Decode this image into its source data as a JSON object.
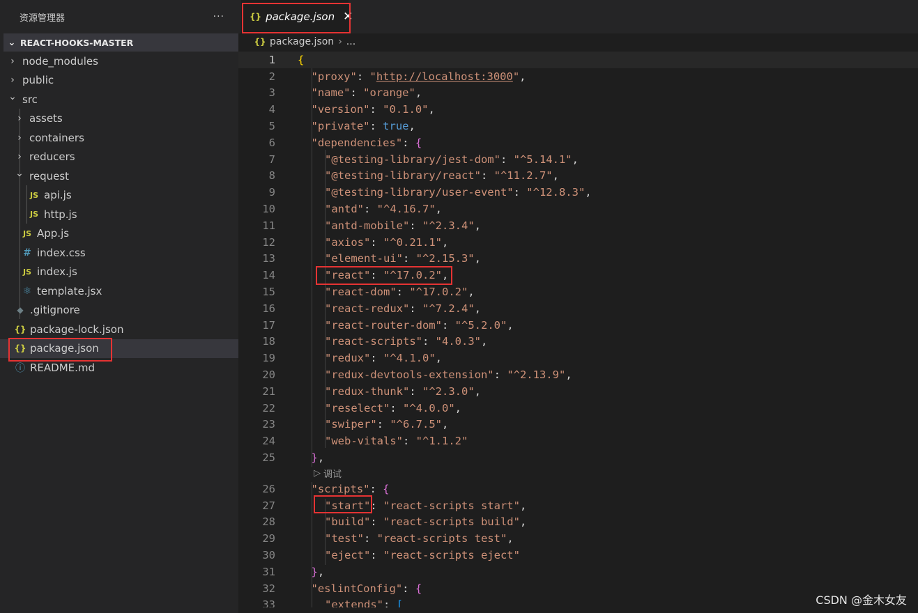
{
  "explorer": {
    "title": "资源管理器",
    "more_label": "···",
    "section_label": "REACT-HOOKS-MASTER",
    "items": [
      {
        "label": "node_modules",
        "kind": "folder",
        "expanded": false,
        "depth": 0,
        "icon": "chevron-right-icon"
      },
      {
        "label": "public",
        "kind": "folder",
        "expanded": false,
        "depth": 0,
        "icon": "chevron-right-icon"
      },
      {
        "label": "src",
        "kind": "folder",
        "expanded": true,
        "depth": 0,
        "icon": "chevron-down-icon"
      },
      {
        "label": "assets",
        "kind": "folder",
        "expanded": false,
        "depth": 1,
        "icon": "chevron-right-icon"
      },
      {
        "label": "containers",
        "kind": "folder",
        "expanded": false,
        "depth": 1,
        "icon": "chevron-right-icon"
      },
      {
        "label": "reducers",
        "kind": "folder",
        "expanded": false,
        "depth": 1,
        "icon": "chevron-right-icon"
      },
      {
        "label": "request",
        "kind": "folder",
        "expanded": true,
        "depth": 1,
        "icon": "chevron-down-icon"
      },
      {
        "label": "api.js",
        "kind": "file",
        "depth": 2,
        "icon": "js-file-icon",
        "glyph": "JS"
      },
      {
        "label": "http.js",
        "kind": "file",
        "depth": 2,
        "icon": "js-file-icon",
        "glyph": "JS"
      },
      {
        "label": "App.js",
        "kind": "file",
        "depth": 1,
        "icon": "js-file-icon",
        "glyph": "JS"
      },
      {
        "label": "index.css",
        "kind": "file",
        "depth": 1,
        "icon": "css-file-icon",
        "glyph": "#"
      },
      {
        "label": "index.js",
        "kind": "file",
        "depth": 1,
        "icon": "js-file-icon",
        "glyph": "JS"
      },
      {
        "label": "template.jsx",
        "kind": "file",
        "depth": 1,
        "icon": "react-file-icon",
        "glyph": "⚛"
      },
      {
        "label": ".gitignore",
        "kind": "file",
        "depth": 0,
        "icon": "git-file-icon",
        "glyph": "◆"
      },
      {
        "label": "package-lock.json",
        "kind": "file",
        "depth": 0,
        "icon": "json-file-icon",
        "glyph": "{}"
      },
      {
        "label": "package.json",
        "kind": "file",
        "depth": 0,
        "icon": "json-file-icon",
        "glyph": "{}",
        "selected": true
      },
      {
        "label": "README.md",
        "kind": "file",
        "depth": 0,
        "icon": "info-file-icon",
        "glyph": "ⓘ"
      }
    ]
  },
  "tab": {
    "glyph": "{}",
    "label": "package.json",
    "close": "✕"
  },
  "breadcrumb": {
    "glyph": "{}",
    "file": "package.json",
    "sep": "›",
    "rest": "..."
  },
  "codelens": {
    "glyph": "▷",
    "label": "调试"
  },
  "editor": {
    "current_line": 1,
    "lines": [
      {
        "n": "1",
        "indent": 0,
        "parts": [
          {
            "t": "{",
            "c": "br1"
          }
        ]
      },
      {
        "n": "2",
        "indent": 1,
        "parts": [
          {
            "t": "\"proxy\"",
            "c": "kq"
          },
          {
            "t": ": ",
            "c": "p"
          },
          {
            "t": "\"",
            "c": "s"
          },
          {
            "t": "http://localhost:3000",
            "c": "s u"
          },
          {
            "t": "\"",
            "c": "s"
          },
          {
            "t": ",",
            "c": "p"
          }
        ]
      },
      {
        "n": "3",
        "indent": 1,
        "parts": [
          {
            "t": "\"name\"",
            "c": "kq"
          },
          {
            "t": ": ",
            "c": "p"
          },
          {
            "t": "\"orange\"",
            "c": "s"
          },
          {
            "t": ",",
            "c": "p"
          }
        ]
      },
      {
        "n": "4",
        "indent": 1,
        "parts": [
          {
            "t": "\"version\"",
            "c": "kq"
          },
          {
            "t": ": ",
            "c": "p"
          },
          {
            "t": "\"0.1.0\"",
            "c": "s"
          },
          {
            "t": ",",
            "c": "p"
          }
        ]
      },
      {
        "n": "5",
        "indent": 1,
        "parts": [
          {
            "t": "\"private\"",
            "c": "kq"
          },
          {
            "t": ": ",
            "c": "p"
          },
          {
            "t": "true",
            "c": "b"
          },
          {
            "t": ",",
            "c": "p"
          }
        ]
      },
      {
        "n": "6",
        "indent": 1,
        "parts": [
          {
            "t": "\"dependencies\"",
            "c": "kq"
          },
          {
            "t": ": ",
            "c": "p"
          },
          {
            "t": "{",
            "c": "br2"
          }
        ]
      },
      {
        "n": "7",
        "indent": 2,
        "parts": [
          {
            "t": "\"@testing-library/jest-dom\"",
            "c": "kq"
          },
          {
            "t": ": ",
            "c": "p"
          },
          {
            "t": "\"^5.14.1\"",
            "c": "s"
          },
          {
            "t": ",",
            "c": "p"
          }
        ]
      },
      {
        "n": "8",
        "indent": 2,
        "parts": [
          {
            "t": "\"@testing-library/react\"",
            "c": "kq"
          },
          {
            "t": ": ",
            "c": "p"
          },
          {
            "t": "\"^11.2.7\"",
            "c": "s"
          },
          {
            "t": ",",
            "c": "p"
          }
        ]
      },
      {
        "n": "9",
        "indent": 2,
        "parts": [
          {
            "t": "\"@testing-library/user-event\"",
            "c": "kq"
          },
          {
            "t": ": ",
            "c": "p"
          },
          {
            "t": "\"^12.8.3\"",
            "c": "s"
          },
          {
            "t": ",",
            "c": "p"
          }
        ]
      },
      {
        "n": "10",
        "indent": 2,
        "parts": [
          {
            "t": "\"antd\"",
            "c": "kq"
          },
          {
            "t": ": ",
            "c": "p"
          },
          {
            "t": "\"^4.16.7\"",
            "c": "s"
          },
          {
            "t": ",",
            "c": "p"
          }
        ]
      },
      {
        "n": "11",
        "indent": 2,
        "parts": [
          {
            "t": "\"antd-mobile\"",
            "c": "kq"
          },
          {
            "t": ": ",
            "c": "p"
          },
          {
            "t": "\"^2.3.4\"",
            "c": "s"
          },
          {
            "t": ",",
            "c": "p"
          }
        ]
      },
      {
        "n": "12",
        "indent": 2,
        "parts": [
          {
            "t": "\"axios\"",
            "c": "kq"
          },
          {
            "t": ": ",
            "c": "p"
          },
          {
            "t": "\"^0.21.1\"",
            "c": "s"
          },
          {
            "t": ",",
            "c": "p"
          }
        ]
      },
      {
        "n": "13",
        "indent": 2,
        "parts": [
          {
            "t": "\"element-ui\"",
            "c": "kq"
          },
          {
            "t": ": ",
            "c": "p"
          },
          {
            "t": "\"^2.15.3\"",
            "c": "s"
          },
          {
            "t": ",",
            "c": "p"
          }
        ]
      },
      {
        "n": "14",
        "indent": 2,
        "parts": [
          {
            "t": "\"react\"",
            "c": "kq"
          },
          {
            "t": ": ",
            "c": "p"
          },
          {
            "t": "\"^17.0.2\"",
            "c": "s"
          },
          {
            "t": ",",
            "c": "p"
          }
        ]
      },
      {
        "n": "15",
        "indent": 2,
        "parts": [
          {
            "t": "\"react-dom\"",
            "c": "kq"
          },
          {
            "t": ": ",
            "c": "p"
          },
          {
            "t": "\"^17.0.2\"",
            "c": "s"
          },
          {
            "t": ",",
            "c": "p"
          }
        ]
      },
      {
        "n": "16",
        "indent": 2,
        "parts": [
          {
            "t": "\"react-redux\"",
            "c": "kq"
          },
          {
            "t": ": ",
            "c": "p"
          },
          {
            "t": "\"^7.2.4\"",
            "c": "s"
          },
          {
            "t": ",",
            "c": "p"
          }
        ]
      },
      {
        "n": "17",
        "indent": 2,
        "parts": [
          {
            "t": "\"react-router-dom\"",
            "c": "kq"
          },
          {
            "t": ": ",
            "c": "p"
          },
          {
            "t": "\"^5.2.0\"",
            "c": "s"
          },
          {
            "t": ",",
            "c": "p"
          }
        ]
      },
      {
        "n": "18",
        "indent": 2,
        "parts": [
          {
            "t": "\"react-scripts\"",
            "c": "kq"
          },
          {
            "t": ": ",
            "c": "p"
          },
          {
            "t": "\"4.0.3\"",
            "c": "s"
          },
          {
            "t": ",",
            "c": "p"
          }
        ]
      },
      {
        "n": "19",
        "indent": 2,
        "parts": [
          {
            "t": "\"redux\"",
            "c": "kq"
          },
          {
            "t": ": ",
            "c": "p"
          },
          {
            "t": "\"^4.1.0\"",
            "c": "s"
          },
          {
            "t": ",",
            "c": "p"
          }
        ]
      },
      {
        "n": "20",
        "indent": 2,
        "parts": [
          {
            "t": "\"redux-devtools-extension\"",
            "c": "kq"
          },
          {
            "t": ": ",
            "c": "p"
          },
          {
            "t": "\"^2.13.9\"",
            "c": "s"
          },
          {
            "t": ",",
            "c": "p"
          }
        ]
      },
      {
        "n": "21",
        "indent": 2,
        "parts": [
          {
            "t": "\"redux-thunk\"",
            "c": "kq"
          },
          {
            "t": ": ",
            "c": "p"
          },
          {
            "t": "\"^2.3.0\"",
            "c": "s"
          },
          {
            "t": ",",
            "c": "p"
          }
        ]
      },
      {
        "n": "22",
        "indent": 2,
        "parts": [
          {
            "t": "\"reselect\"",
            "c": "kq"
          },
          {
            "t": ": ",
            "c": "p"
          },
          {
            "t": "\"^4.0.0\"",
            "c": "s"
          },
          {
            "t": ",",
            "c": "p"
          }
        ]
      },
      {
        "n": "23",
        "indent": 2,
        "parts": [
          {
            "t": "\"swiper\"",
            "c": "kq"
          },
          {
            "t": ": ",
            "c": "p"
          },
          {
            "t": "\"^6.7.5\"",
            "c": "s"
          },
          {
            "t": ",",
            "c": "p"
          }
        ]
      },
      {
        "n": "24",
        "indent": 2,
        "parts": [
          {
            "t": "\"web-vitals\"",
            "c": "kq"
          },
          {
            "t": ": ",
            "c": "p"
          },
          {
            "t": "\"^1.1.2\"",
            "c": "s"
          }
        ]
      },
      {
        "n": "25",
        "indent": 1,
        "parts": [
          {
            "t": "}",
            "c": "br2"
          },
          {
            "t": ",",
            "c": "p"
          }
        ]
      },
      {
        "n": "26",
        "indent": 1,
        "parts": [
          {
            "t": "\"scripts\"",
            "c": "kq"
          },
          {
            "t": ": ",
            "c": "p"
          },
          {
            "t": "{",
            "c": "br2"
          }
        ]
      },
      {
        "n": "27",
        "indent": 2,
        "parts": [
          {
            "t": "\"start\"",
            "c": "kq"
          },
          {
            "t": ": ",
            "c": "p"
          },
          {
            "t": "\"react-scripts start\"",
            "c": "s"
          },
          {
            "t": ",",
            "c": "p"
          }
        ]
      },
      {
        "n": "28",
        "indent": 2,
        "parts": [
          {
            "t": "\"build\"",
            "c": "kq"
          },
          {
            "t": ": ",
            "c": "p"
          },
          {
            "t": "\"react-scripts build\"",
            "c": "s"
          },
          {
            "t": ",",
            "c": "p"
          }
        ]
      },
      {
        "n": "29",
        "indent": 2,
        "parts": [
          {
            "t": "\"test\"",
            "c": "kq"
          },
          {
            "t": ": ",
            "c": "p"
          },
          {
            "t": "\"react-scripts test\"",
            "c": "s"
          },
          {
            "t": ",",
            "c": "p"
          }
        ]
      },
      {
        "n": "30",
        "indent": 2,
        "parts": [
          {
            "t": "\"eject\"",
            "c": "kq"
          },
          {
            "t": ": ",
            "c": "p"
          },
          {
            "t": "\"react-scripts eject\"",
            "c": "s"
          }
        ]
      },
      {
        "n": "31",
        "indent": 1,
        "parts": [
          {
            "t": "}",
            "c": "br2"
          },
          {
            "t": ",",
            "c": "p"
          }
        ]
      },
      {
        "n": "32",
        "indent": 1,
        "parts": [
          {
            "t": "\"eslintConfig\"",
            "c": "kq"
          },
          {
            "t": ": ",
            "c": "p"
          },
          {
            "t": "{",
            "c": "br2"
          }
        ]
      },
      {
        "n": "33",
        "indent": 2,
        "parts": [
          {
            "t": "\"extends\"",
            "c": "kq"
          },
          {
            "t": ": ",
            "c": "p"
          },
          {
            "t": "[",
            "c": "br3"
          }
        ]
      }
    ]
  },
  "watermark": "CSDN @金木女友",
  "colors": {
    "highlight_box": "#e53333",
    "selection_bg": "#37373d",
    "editor_bg": "#1e1e1e",
    "sidebar_bg": "#252526"
  }
}
